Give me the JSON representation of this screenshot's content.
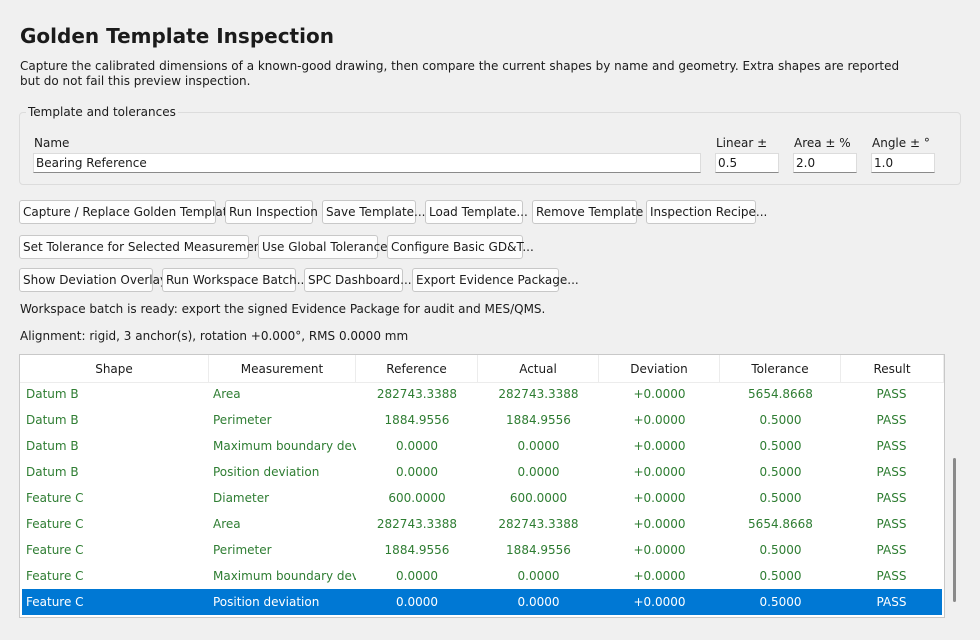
{
  "header": {
    "title": "Golden Template Inspection",
    "description": "Capture the calibrated dimensions of a known-good drawing, then compare the current shapes by name and geometry. Extra shapes are reported but do not fail this preview inspection."
  },
  "template": {
    "group_label": "Template and tolerances",
    "name_label": "Name",
    "name_value": "Bearing Reference",
    "linear_label": "Linear ±",
    "linear_value": "0.5",
    "area_label": "Area ± %",
    "area_value": "2.0",
    "angle_label": "Angle ± °",
    "angle_value": "1.0"
  },
  "buttons": {
    "row1": [
      "Capture / Replace Golden Template",
      "Run Inspection",
      "Save Template...",
      "Load Template...",
      "Remove Template",
      "Inspection Recipe..."
    ],
    "row2": [
      "Set Tolerance for Selected Measurement...",
      "Use Global Tolerance",
      "Configure Basic GD&T..."
    ],
    "row3": [
      "Show Deviation Overlay",
      "Run Workspace Batch...",
      "SPC Dashboard...",
      "Export Evidence Package..."
    ]
  },
  "status": {
    "batch": "Workspace batch is ready: export the signed Evidence Package for audit and MES/QMS.",
    "alignment": "Alignment: rigid, 3 anchor(s), rotation +0.000°, RMS 0.0000 mm"
  },
  "table": {
    "columns": [
      "Shape",
      "Measurement",
      "Reference",
      "Actual",
      "Deviation",
      "Tolerance",
      "Result"
    ],
    "rows": [
      [
        "Datum B",
        "Area",
        "282743.3388",
        "282743.3388",
        "+0.0000",
        "5654.8668",
        "PASS"
      ],
      [
        "Datum B",
        "Perimeter",
        "1884.9556",
        "1884.9556",
        "+0.0000",
        "0.5000",
        "PASS"
      ],
      [
        "Datum B",
        "Maximum boundary devia",
        "0.0000",
        "0.0000",
        "+0.0000",
        "0.5000",
        "PASS"
      ],
      [
        "Datum B",
        "Position deviation",
        "0.0000",
        "0.0000",
        "+0.0000",
        "0.5000",
        "PASS"
      ],
      [
        "Feature C",
        "Diameter",
        "600.0000",
        "600.0000",
        "+0.0000",
        "0.5000",
        "PASS"
      ],
      [
        "Feature C",
        "Area",
        "282743.3388",
        "282743.3388",
        "+0.0000",
        "5654.8668",
        "PASS"
      ],
      [
        "Feature C",
        "Perimeter",
        "1884.9556",
        "1884.9556",
        "+0.0000",
        "0.5000",
        "PASS"
      ],
      [
        "Feature C",
        "Maximum boundary devia",
        "0.0000",
        "0.0000",
        "+0.0000",
        "0.5000",
        "PASS"
      ],
      [
        "Feature C",
        "Position deviation",
        "0.0000",
        "0.0000",
        "+0.0000",
        "0.5000",
        "PASS"
      ]
    ],
    "selected_row": 8
  },
  "colors": {
    "pass_text": "#2e7d32",
    "selection": "#0078d4"
  }
}
